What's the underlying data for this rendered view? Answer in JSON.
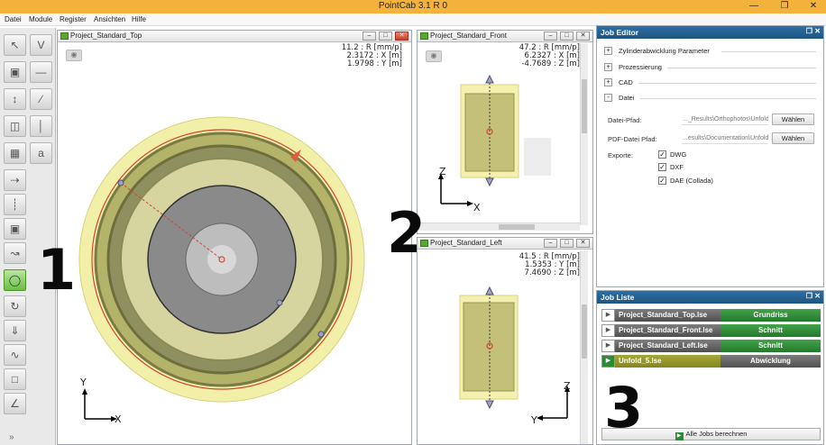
{
  "app": {
    "title": "PointCab 3.1 R 0",
    "window_controls": [
      "—",
      "❐",
      "✕"
    ]
  },
  "menu": [
    "Datei",
    "Module",
    "Register",
    "Ansichten",
    "Hilfe"
  ],
  "toolbar": {
    "buttons": [
      {
        "icon": "select-arrow-icon"
      },
      {
        "icon": "section-v-icon"
      },
      {
        "icon": "orthophoto-icon"
      },
      {
        "icon": "line-tool-icon"
      },
      {
        "icon": "move-icon"
      },
      {
        "icon": "diagonal-line-icon"
      },
      {
        "icon": "layers-icon"
      },
      {
        "icon": "vertical-line-icon"
      },
      {
        "icon": "calculator-icon"
      },
      {
        "icon": "text-tool-icon"
      },
      {
        "icon": "measure-icon"
      },
      {
        "icon": "slice-icon"
      },
      {
        "icon": "cube-icon"
      },
      {
        "icon": "walk-icon"
      },
      {
        "icon": "cylinder-icon"
      },
      {
        "icon": "rotate-icon"
      },
      {
        "icon": "flatten-icon"
      },
      {
        "icon": "curve-icon"
      },
      {
        "icon": "section-box-icon"
      },
      {
        "icon": "angle-icon"
      }
    ],
    "more": "»"
  },
  "views": {
    "top": {
      "title": "Project_Standard_Top",
      "readout": "11.2 : R [mm/p]\n2.3172 : X [m]\n1.9798 : Y [m]",
      "axis_v": "Y",
      "axis_h": "X",
      "annotation": "1",
      "eye_icon": "◉"
    },
    "front": {
      "title": "Project_Standard_Front",
      "readout": "47.2 : R [mm/p]\n6.2327 : X [m]\n-4.7689 : Z [m]",
      "axis_v": "Z",
      "axis_h": "X",
      "annotation": "2",
      "eye_icon": "◉"
    },
    "left": {
      "title": "Project_Standard_Left",
      "readout": "41.5 : R [mm/p]\n1.5353 : Y [m]\n7.4690 : Z [m]",
      "axis_v": "Z",
      "axis_h": "Y"
    }
  },
  "pane_buttons": {
    "min": "–",
    "max": "□",
    "close": "✕"
  },
  "job_editor": {
    "title": "Job Editor",
    "controls": "❒ ✕",
    "sections": [
      {
        "toggle": "+",
        "label": "Zylinderabwicklung Parameter"
      },
      {
        "toggle": "+",
        "label": "Prozessierung"
      },
      {
        "toggle": "+",
        "label": "CAD"
      },
      {
        "toggle": "-",
        "label": "Datei"
      }
    ],
    "file_path_label": "Datei-Pfad:",
    "file_path_value": "..._Results\\Orthophotos\\Unfold_5.lse",
    "pdf_path_label": "PDF-Datei Pfad:",
    "pdf_path_value": "...esults\\Documentation\\Unfold_5.pdf",
    "choose_label": "Wählen",
    "exports_label": "Exporte:",
    "exports": [
      {
        "label": "DWG",
        "checked": "✓"
      },
      {
        "label": "DXF",
        "checked": "✓"
      },
      {
        "label": "DAE (Collada)",
        "checked": "✓"
      }
    ]
  },
  "job_list": {
    "title": "Job Liste",
    "controls": "❒ ✕",
    "jobs": [
      {
        "name": "Project_Standard_Top.lse",
        "type": "Grundriss"
      },
      {
        "name": "Project_Standard_Front.lse",
        "type": "Schnitt"
      },
      {
        "name": "Project_Standard_Left.lse",
        "type": "Schnitt"
      },
      {
        "name": "Unfold_5.lse",
        "type": "Abwicklung"
      }
    ],
    "annotation": "3",
    "run_all_label": "Alle Jobs berechnen"
  }
}
